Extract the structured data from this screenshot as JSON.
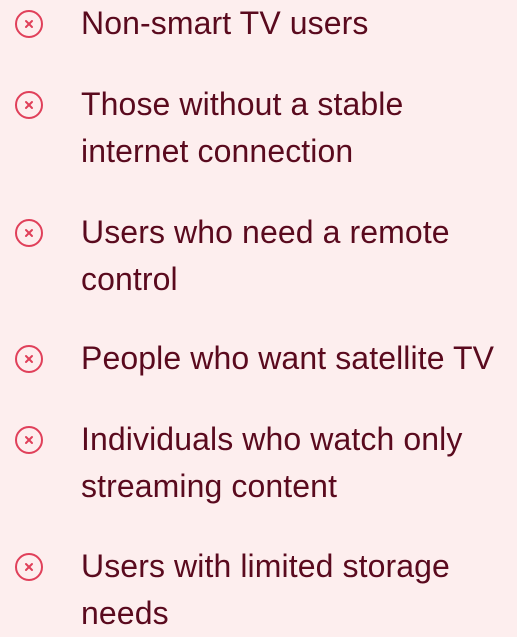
{
  "colors": {
    "background": "#fdeeee",
    "text": "#5a0a1e",
    "icon": "#e0405a"
  },
  "list": {
    "items": [
      {
        "icon": "x-circle-icon",
        "label": "Non-smart TV users"
      },
      {
        "icon": "x-circle-icon",
        "label": "Those without a stable internet connection"
      },
      {
        "icon": "x-circle-icon",
        "label": "Users who need a remote control"
      },
      {
        "icon": "x-circle-icon",
        "label": "People who want satellite TV"
      },
      {
        "icon": "x-circle-icon",
        "label": "Individuals who watch only streaming content"
      },
      {
        "icon": "x-circle-icon",
        "label": "Users with limited storage needs"
      }
    ]
  }
}
